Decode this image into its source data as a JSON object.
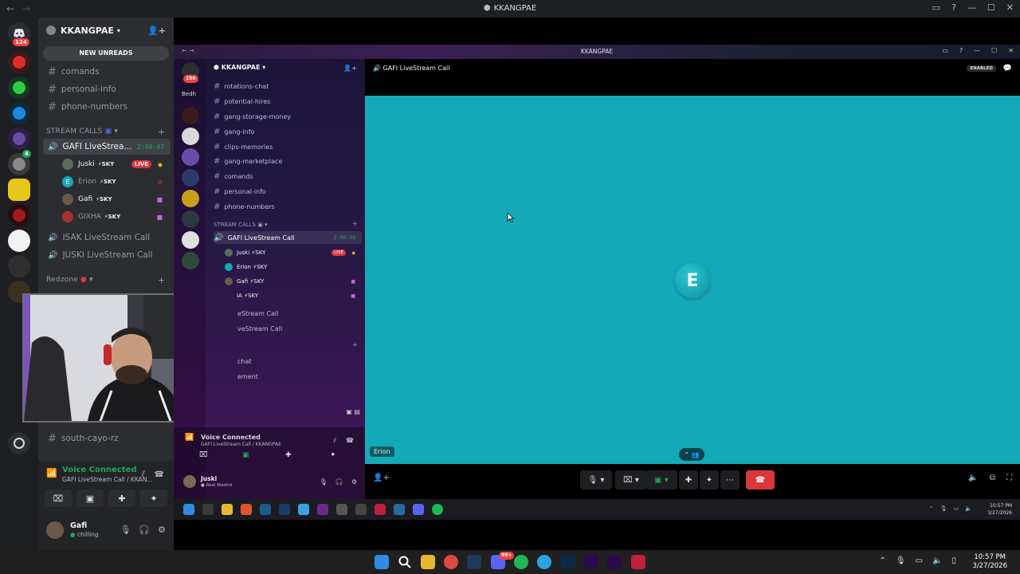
{
  "window": {
    "title": "KKANGPAE"
  },
  "rail": {
    "home_badge": "124",
    "friend_badge": "4"
  },
  "sidebar": {
    "server_name": "KKANGPAE",
    "new_unreads": "NEW UNREADS",
    "channels_top": [
      "comands",
      "personal-info",
      "phone-numbers"
    ],
    "stream_calls_category": "STREAM CALLS",
    "active_call": {
      "name": "GAFI LiveStrea...",
      "time": "2:08:47"
    },
    "voice_users": [
      {
        "name": "Juski",
        "tag": "SKY",
        "live": "LIVE"
      },
      {
        "name": "Erion",
        "tag": "SKY",
        "initial": "E"
      },
      {
        "name": "Gafi",
        "tag": "SKY"
      },
      {
        "name": "GIXHA",
        "tag": "SKY"
      }
    ],
    "other_calls": [
      "ISAK LiveStream Call",
      "JUSKI LiveStream Call"
    ],
    "redzone_category": "Redzone",
    "bottom_channel": "south-cayo-rz"
  },
  "voice_panel": {
    "status": "Voice Connected",
    "channel": "GAFI LiveStream Call / KKAN..."
  },
  "user": {
    "name": "Gafi",
    "status": "chilling"
  },
  "share": {
    "title": "KKANGPAE",
    "rail_badge": "156",
    "rail_label": "Bedh",
    "server_name": "KKANGPAE",
    "channels": [
      "rotations-chat",
      "potential-hires",
      "gang-storage-money",
      "gang-info",
      "clips-memories",
      "gang-marketplace",
      "comands",
      "personal-info",
      "phone-numbers"
    ],
    "stream_calls_category": "STREAM CALLS",
    "active_call": {
      "name": "GAFI LiveStream Call",
      "time": "2:08:39"
    },
    "voice_users": [
      {
        "name": "Juski",
        "tag": "SKY",
        "live": "LIVE"
      },
      {
        "name": "Erion",
        "tag": "SKY"
      },
      {
        "name": "Gafi",
        "tag": "SKY"
      },
      {
        "name": "IA",
        "tag": "SKY"
      }
    ],
    "partial_calls": [
      "eStream Call",
      "veStream Call"
    ],
    "partial_channels": [
      "chat",
      "ement"
    ],
    "voice_status": "Voice Connected",
    "voice_channel": "GAFI LiveStream Call / KKANGPAE",
    "user_name": "Juski",
    "user_status": "Real Madrid",
    "stream_title": "GAFI LiveStream Call",
    "enabled_label": "ENABLED",
    "stream_user_initial": "E",
    "stream_user_name": "Erion",
    "clock_time": "10:57 PM",
    "clock_date": "3/27/2026"
  },
  "taskbar": {
    "time": "10:57 PM",
    "date": "3/27/2026",
    "discord_badge": "99+"
  },
  "colors": {
    "stream_bg": "#14a9b8",
    "voice_green": "#23a55a",
    "live_red": "#da373c",
    "end_call": "#da373c"
  }
}
